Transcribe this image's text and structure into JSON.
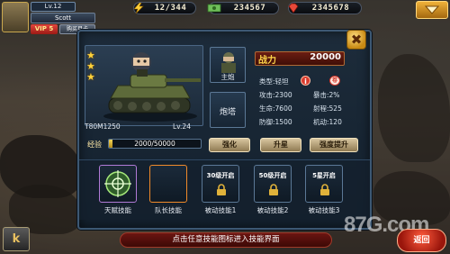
{
  "player": {
    "level": "Lv.12",
    "name": "Scott",
    "vip": "VIP 5",
    "buy_month": "购买月卡"
  },
  "resources": [
    {
      "icon": "stamina-icon",
      "value": "12/344"
    },
    {
      "icon": "money-icon",
      "value": "234567"
    },
    {
      "icon": "gem-icon",
      "value": "2345678"
    }
  ],
  "tank": {
    "model": "T80M1250",
    "level": "Lv.24",
    "stars": 3,
    "exp_label": "经验",
    "exp_text": "2000/50000",
    "exp_fraction": 0.04
  },
  "slots": {
    "main_gun": "主炮",
    "turret": "炮塔"
  },
  "stats": {
    "power_label": "战力",
    "power_value": "20000",
    "type": "类型:轻坦",
    "attack": "攻击:2300",
    "crit": "暴击:2%",
    "hp": "生命:7600",
    "range": "射程:525",
    "defense": "防御:1500",
    "mobility": "机动:120",
    "info_glyph": "i",
    "tag_glyph": "卷"
  },
  "buttons": {
    "enhance": "强化",
    "upgrade": "升星",
    "strength_up": "强度提升",
    "close": "✖",
    "back": "返回"
  },
  "skills": [
    {
      "label": "天赋技能",
      "lock": "",
      "locked": false
    },
    {
      "label": "队长技能",
      "lock": "",
      "locked": false
    },
    {
      "label": "被动技能1",
      "lock": "30级开启",
      "locked": true
    },
    {
      "label": "被动技能2",
      "lock": "50级开启",
      "locked": true
    },
    {
      "label": "被动技能3",
      "lock": "5星开启",
      "locked": true
    }
  ],
  "hint": "点击任意技能图标进入技能界面",
  "watermark": "87G.com",
  "side_glyph": "k",
  "colors": {
    "panel_border": "#3d5873",
    "accent_gold": "#ffd64a",
    "power_bg": "#6b1d12",
    "hint_bg": "#6b1511"
  }
}
